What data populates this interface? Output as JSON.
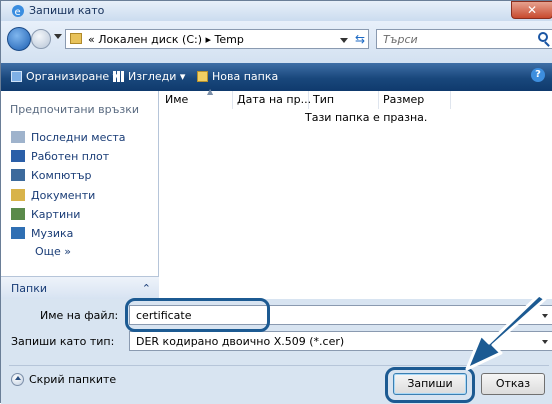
{
  "window": {
    "title": "Запиши като",
    "close_label": "✕"
  },
  "address": {
    "crumbs": "«  Локален диск (C:)  ▸  Temp",
    "search_placeholder": "Търси"
  },
  "toolbar": {
    "organize": "Организиране  ▾",
    "views": "Изгледи  ▾",
    "new_folder": "Нова папка",
    "help": "?"
  },
  "sidebar": {
    "header": "Предпочитани връзки",
    "items": [
      {
        "label": "Последни места",
        "icon": "recent-places-icon"
      },
      {
        "label": "Работен плот",
        "icon": "desktop-icon"
      },
      {
        "label": "Компютър",
        "icon": "computer-icon"
      },
      {
        "label": "Документи",
        "icon": "documents-icon"
      },
      {
        "label": "Картини",
        "icon": "pictures-icon"
      },
      {
        "label": "Музика",
        "icon": "music-icon"
      }
    ],
    "more": "Още  »",
    "folders": "Папки",
    "folders_chevron": "⌃"
  },
  "filelist": {
    "columns": [
      "Име",
      "Дата на пр...",
      "Тип",
      "Размер"
    ],
    "empty_message": "Тази папка е празна."
  },
  "form": {
    "filename_label": "Име на файл:",
    "filename_value": "certificate",
    "filetype_label": "Запиши като тип:",
    "filetype_value": "DER кодирано двоично X.509 (*.cer)"
  },
  "footer": {
    "hide_folders": "Скрий папките",
    "save": "Запиши",
    "cancel": "Отказ"
  },
  "colors": {
    "accent": "#1c5a92",
    "toolbar": "#19477c"
  }
}
